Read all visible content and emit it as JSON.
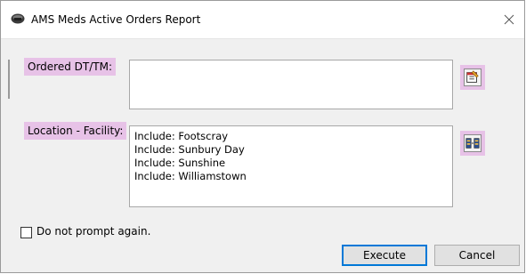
{
  "window": {
    "title": "AMS Meds Active Orders Report"
  },
  "ordered": {
    "label": "Ordered DT/TM:",
    "value_lines": []
  },
  "location": {
    "label": "Location - Facility:",
    "value_lines": [
      "Include: Footscray",
      "Include: Sunbury Day",
      "Include: Sunshine",
      "Include: Williamstown"
    ]
  },
  "options": {
    "no_prompt_label": "Do not prompt again.",
    "no_prompt_checked": false
  },
  "buttons": {
    "execute_label": "Execute",
    "cancel_label": "Cancel"
  },
  "colors": {
    "label_highlight": "#e7c2e7",
    "default_button_border": "#0078d7"
  },
  "icons": {
    "app": "database-icon",
    "close": "close-icon",
    "date_picker": "calendar-picker-icon",
    "location_picker": "location-picker-icon"
  }
}
